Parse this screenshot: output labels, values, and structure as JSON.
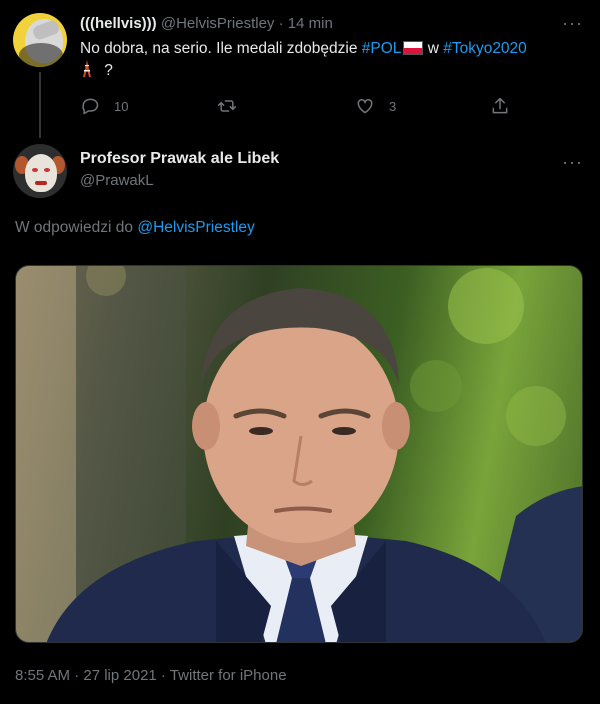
{
  "parent_tweet": {
    "display_name": "(((hellvis)))",
    "handle": "@HelvisPriestley",
    "separator": "·",
    "time": "14 min",
    "text_start": "No dobra, na serio. Ile medali zdobędzie ",
    "hashtag_pol": "#POL",
    "text_mid": " w ",
    "hashtag_tokyo": "#Tokyo2020",
    "text_end": " ?",
    "counts": {
      "replies": "10",
      "likes": "3"
    },
    "icons": [
      "reply-icon",
      "retweet-icon",
      "like-icon",
      "share-icon",
      "more-icon",
      "poland-flag-icon",
      "tokyo-tower-icon"
    ]
  },
  "main_tweet": {
    "display_name": "Profesor Prawak ale Libek",
    "handle": "@PrawakL",
    "reply_prefix": "W odpowiedzi do ",
    "reply_mention": "@HelvisPriestley",
    "footer": "8:55 AM · 27 lip 2021 · Twitter for iPhone"
  },
  "colors": {
    "background": "#000000",
    "text_primary": "#e7e9ea",
    "text_secondary": "#71767b",
    "accent": "#1d9bf0"
  }
}
